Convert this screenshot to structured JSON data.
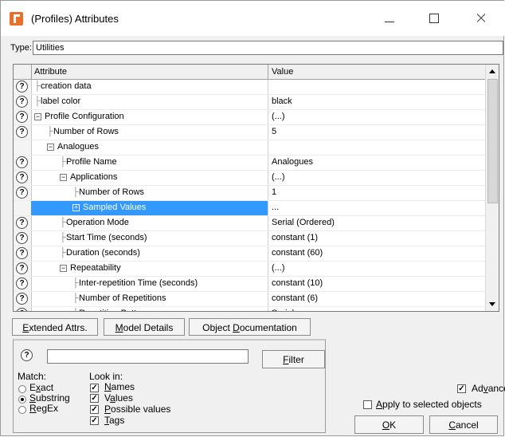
{
  "window": {
    "title": "(Profiles) Attributes"
  },
  "type_field": {
    "label": "Type:",
    "value": "Utilities"
  },
  "grid": {
    "headers": {
      "attribute": "Attribute",
      "value": "Value"
    },
    "rows": [
      {
        "attr": "creation data",
        "value": "",
        "indent": 0,
        "prefix": "├",
        "expander": "",
        "help": true
      },
      {
        "attr": "label color",
        "value": "black",
        "indent": 0,
        "prefix": "├",
        "expander": "",
        "help": true
      },
      {
        "attr": "Profile Configuration",
        "value": "(...)",
        "indent": 0,
        "prefix": "",
        "expander": "minus",
        "help": true
      },
      {
        "attr": "Number of Rows",
        "value": "5",
        "indent": 1,
        "prefix": "├",
        "expander": "",
        "help": true
      },
      {
        "attr": "Analogues",
        "value": "",
        "indent": 1,
        "prefix": "",
        "expander": "minus",
        "help": false
      },
      {
        "attr": "Profile Name",
        "value": "Analogues",
        "indent": 2,
        "prefix": "├",
        "expander": "",
        "help": true
      },
      {
        "attr": "Applications",
        "value": "(...)",
        "indent": 2,
        "prefix": "",
        "expander": "minus",
        "help": true
      },
      {
        "attr": "Number of Rows",
        "value": "1",
        "indent": 3,
        "prefix": "├",
        "expander": "",
        "help": true
      },
      {
        "attr": "Sampled Values",
        "value": "...",
        "indent": 3,
        "prefix": "",
        "expander": "plus",
        "help": false,
        "selected": true
      },
      {
        "attr": "Operation Mode",
        "value": "Serial (Ordered)",
        "indent": 2,
        "prefix": "├",
        "expander": "",
        "help": true
      },
      {
        "attr": "Start Time (seconds)",
        "value": "constant (1)",
        "indent": 2,
        "prefix": "├",
        "expander": "",
        "help": true
      },
      {
        "attr": "Duration (seconds)",
        "value": "constant (60)",
        "indent": 2,
        "prefix": "├",
        "expander": "",
        "help": true
      },
      {
        "attr": "Repeatability",
        "value": "(...)",
        "indent": 2,
        "prefix": "",
        "expander": "minus",
        "help": true
      },
      {
        "attr": "Inter-repetition Time (seconds)",
        "value": "constant (10)",
        "indent": 3,
        "prefix": "├",
        "expander": "",
        "help": true
      },
      {
        "attr": "Number of Repetitions",
        "value": "constant (6)",
        "indent": 3,
        "prefix": "├",
        "expander": "",
        "help": true
      },
      {
        "attr": "Repetition Pattern",
        "value": "Serial",
        "indent": 3,
        "prefix": "└",
        "expander": "",
        "help": true
      }
    ]
  },
  "buttons": {
    "extended": "Extended Attrs.",
    "model": "Model Details",
    "documentation": "Object Documentation",
    "filter": "Filter",
    "ok": "OK",
    "cancel": "Cancel"
  },
  "search": {
    "query": "",
    "match_label": "Match:",
    "match_options": [
      {
        "label": "Exact",
        "checked": false
      },
      {
        "label": "Substring",
        "checked": true
      },
      {
        "label": "RegEx",
        "checked": false
      }
    ],
    "lookin_label": "Look in:",
    "lookin_options": [
      {
        "label": "Names",
        "checked": true
      },
      {
        "label": "Values",
        "checked": true
      },
      {
        "label": "Possible values",
        "checked": true
      },
      {
        "label": "Tags",
        "checked": true
      }
    ]
  },
  "advanced": {
    "label": "Advanced",
    "checked": true
  },
  "apply_selected": {
    "label": "Apply to selected objects",
    "checked": false
  },
  "colors": {
    "selection": "#3399ff",
    "icon_accent": "#e8702a"
  }
}
